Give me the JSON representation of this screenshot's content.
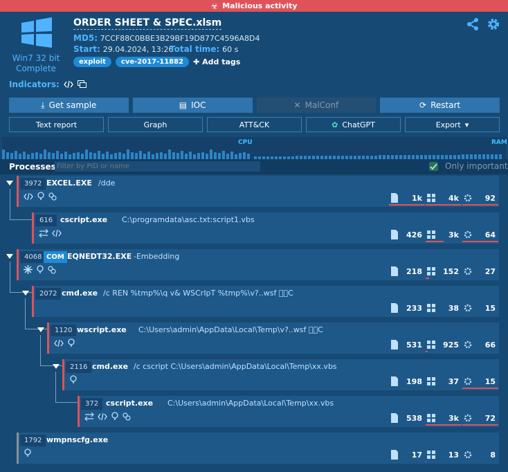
{
  "banner": {
    "label": "Malicious activity"
  },
  "os": {
    "name": "Win7 32 bit",
    "status": "Complete"
  },
  "file": {
    "name": "ORDER SHEET & SPEC.xlsm",
    "md5_label": "MD5:",
    "md5": "7CCF88C0BBE3B29BF19D877C4596A8D4",
    "start_label": "Start:",
    "start": "29.04.2024, 13:26",
    "total_label": "Total time:",
    "total": "60 s",
    "tags": [
      "exploit",
      "cve-2017-11882"
    ],
    "add_tags": "Add tags"
  },
  "indicators_label": "Indicators:",
  "buttons_top": [
    "Get sample",
    "IOC",
    "MalConf",
    "Restart"
  ],
  "buttons_bottom": [
    "Text report",
    "Graph",
    "ATT&CK",
    "ChatGPT",
    "Export"
  ],
  "graph": {
    "cpu_label": "CPU",
    "ram_label": "RAM"
  },
  "processes": {
    "title": "Processes",
    "filter_placeholder": "Filter by PID or name",
    "only_important": "Only important",
    "rows": [
      {
        "pid": "3972",
        "name": "EXCEL.EXE",
        "cmd": "/dde",
        "stats": [
          "1k",
          "4k",
          "92"
        ]
      },
      {
        "pid": "616",
        "name": "cscript.exe",
        "cmd": "C:\\programdata\\asc.txt:script1.vbs",
        "stats": [
          "426",
          "3k",
          "64"
        ]
      },
      {
        "pid": "4068",
        "badge": "COM",
        "name": "EQNEDT32.EXE",
        "cmd": "-Embedding",
        "stats": [
          "218",
          "152",
          "27"
        ]
      },
      {
        "pid": "2072",
        "name": "cmd.exe",
        "cmd": "/c REN %tmp%\\q v& WSCrIpT %tmp%\\v?..wsf \u0000\u0000C",
        "stats": [
          "233",
          "38",
          "15"
        ]
      },
      {
        "pid": "1120",
        "name": "wscript.exe",
        "cmd": "C:\\Users\\admin\\AppData\\Local\\Temp\\v?..wsf \u0000\u0000C",
        "stats": [
          "531",
          "925",
          "66"
        ]
      },
      {
        "pid": "2116",
        "name": "cmd.exe",
        "cmd": "/c cscript C:\\Users\\admin\\AppData\\Local\\Temp\\xx.vbs",
        "stats": [
          "198",
          "37",
          "15"
        ]
      },
      {
        "pid": "372",
        "name": "cscript.exe",
        "cmd": "C:\\Users\\admin\\AppData\\Local\\Temp\\xx.vbs",
        "stats": [
          "538",
          "3k",
          "72"
        ]
      },
      {
        "pid": "1792",
        "name": "wmpnscfg.exe",
        "cmd": "",
        "stats": [
          "17",
          "13",
          "8"
        ]
      }
    ]
  },
  "colors": {
    "accent": "#4fb3ff",
    "danger": "#e0525a",
    "panel": "#1e5888",
    "bg": "#164a74"
  }
}
